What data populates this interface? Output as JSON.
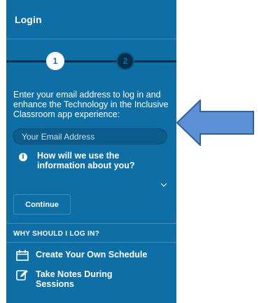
{
  "header": {
    "title": "Login"
  },
  "stepper": {
    "steps": [
      "1",
      "2"
    ],
    "current_step": 1
  },
  "login": {
    "intro_text": "Enter your email address to log in and enhance the Technology in the Inclusive Classroom app experience:",
    "email_placeholder": "Your Email Address",
    "info_text": "How will we use the information about you?",
    "continue_label": "Continue"
  },
  "why": {
    "heading": "WHY SHOULD I LOG IN?",
    "items": [
      {
        "label": "Create Your Own Schedule",
        "icon": "calendar-icon"
      },
      {
        "label": "Take Notes During Sessions",
        "icon": "edit-note-icon"
      }
    ]
  },
  "colors": {
    "panel": "#0d6fa6",
    "step_track": "#02304c",
    "arrow": "#5b8fd6"
  }
}
